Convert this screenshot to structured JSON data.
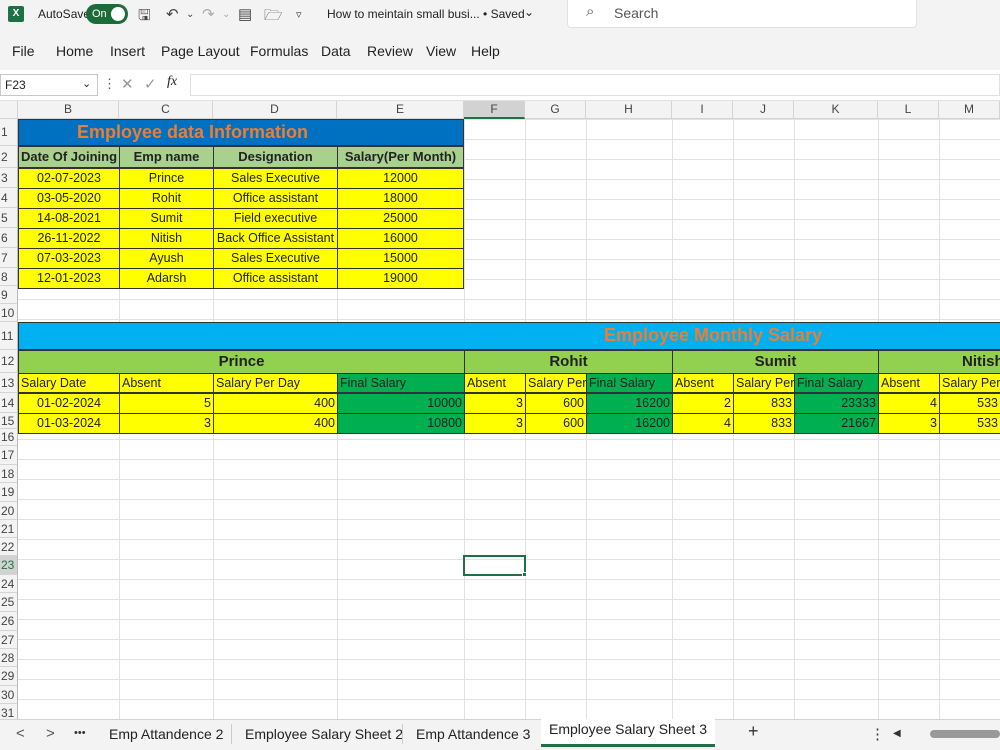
{
  "titlebar": {
    "autosave_label": "AutoSave",
    "toggle_label": "On",
    "doc_title": "How to meintain small busi... • Saved",
    "search_placeholder": "Search"
  },
  "menu": [
    "File",
    "Home",
    "Insert",
    "Page Layout",
    "Formulas",
    "Data",
    "Review",
    "View",
    "Help"
  ],
  "formula_bar": {
    "name_box": "F23",
    "fx": "fx"
  },
  "columns": [
    "B",
    "C",
    "D",
    "E",
    "F",
    "G",
    "H",
    "I",
    "J",
    "K",
    "L",
    "M"
  ],
  "rows": [
    "1",
    "2",
    "3",
    "4",
    "5",
    "6",
    "7",
    "8",
    "9",
    "10",
    "11",
    "12",
    "13",
    "14",
    "15",
    "16",
    "17",
    "18",
    "19",
    "20",
    "21",
    "22",
    "23",
    "24",
    "25",
    "26",
    "27",
    "28",
    "29",
    "30",
    "31"
  ],
  "table1": {
    "title": "Employee data Information",
    "headers": [
      "Date Of Joining",
      "Emp name",
      "Designation",
      "Salary(Per Month)"
    ],
    "rows": [
      [
        "02-07-2023",
        "Prince",
        "Sales Executive",
        "12000"
      ],
      [
        "03-05-2020",
        "Rohit",
        "Office assistant",
        "18000"
      ],
      [
        "14-08-2021",
        "Sumit",
        "Field executive",
        "25000"
      ],
      [
        "26-11-2022",
        "Nitish",
        "Back Office Assistant",
        "16000"
      ],
      [
        "07-03-2023",
        "Ayush",
        "Sales Executive",
        "15000"
      ],
      [
        "12-01-2023",
        "Adarsh",
        "Office assistant",
        "19000"
      ]
    ]
  },
  "table2": {
    "title": "Employee Monthly Salary",
    "groups": [
      "Prince",
      "Rohit",
      "Sumit",
      "Nitish"
    ],
    "prince_headers": [
      "Salary Date",
      "Absent",
      "Salary Per Day",
      "Final Salary"
    ],
    "other_headers": [
      "Absent",
      "Salary Per",
      "Final Salary"
    ],
    "nitish_headers": [
      "Absent",
      "Salary Per"
    ],
    "rows": [
      {
        "date": "01-02-2024",
        "p": [
          "5",
          "400",
          "10000"
        ],
        "r": [
          "3",
          "600",
          "16200"
        ],
        "s": [
          "2",
          "833",
          "23333"
        ],
        "n": [
          "4",
          "533"
        ]
      },
      {
        "date": "01-03-2024",
        "p": [
          "3",
          "400",
          "10800"
        ],
        "r": [
          "3",
          "600",
          "16200"
        ],
        "s": [
          "4",
          "833",
          "21667"
        ],
        "n": [
          "3",
          "533"
        ]
      }
    ]
  },
  "sheet_tabs": [
    "Emp Attandence 2",
    "Employee Salary Sheet 2",
    "Emp Attandence 3",
    "Employee Salary Sheet 3"
  ],
  "tab_nav": {
    "prev": "<",
    "next": ">",
    "more": "•••",
    "add": "+",
    "options": "⋮"
  }
}
